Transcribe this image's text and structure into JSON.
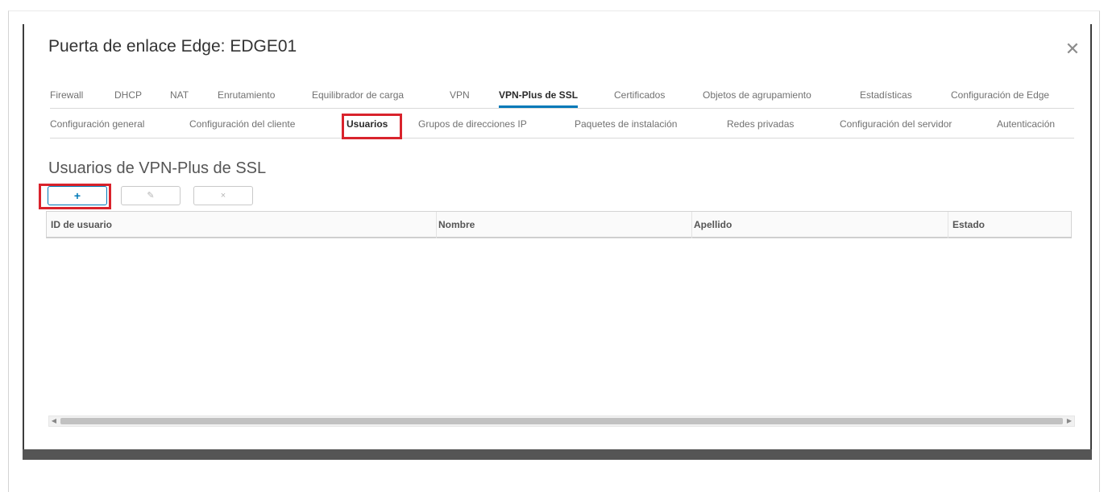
{
  "dialog": {
    "title": "Puerta de enlace Edge: EDGE01",
    "close_icon": "close-icon",
    "tabs": [
      {
        "label": "Firewall",
        "active": false
      },
      {
        "label": "DHCP",
        "active": false
      },
      {
        "label": "NAT",
        "active": false
      },
      {
        "label": "Enrutamiento",
        "active": false
      },
      {
        "label": "Equilibrador de carga",
        "active": false
      },
      {
        "label": "VPN",
        "active": false
      },
      {
        "label": "VPN-Plus de SSL",
        "active": true
      },
      {
        "label": "Certificados",
        "active": false
      },
      {
        "label": "Objetos de agrupamiento",
        "active": false
      },
      {
        "label": "Estadísticas",
        "active": false
      },
      {
        "label": "Configuración de Edge",
        "active": false
      }
    ],
    "subtabs": [
      {
        "label": "Configuración general",
        "active": false
      },
      {
        "label": "Configuración del cliente",
        "active": false
      },
      {
        "label": "Usuarios",
        "active": true
      },
      {
        "label": "Grupos de direcciones IP",
        "active": false
      },
      {
        "label": "Paquetes de instalación",
        "active": false
      },
      {
        "label": "Redes privadas",
        "active": false
      },
      {
        "label": "Configuración del servidor",
        "active": false
      },
      {
        "label": "Autenticación",
        "active": false
      }
    ],
    "section_title": "Usuarios de VPN-Plus de SSL",
    "toolbar": {
      "add_label": "+",
      "edit_icon": "edit-icon",
      "delete_label": "×"
    },
    "grid": {
      "columns": [
        "ID de usuario",
        "Nombre",
        "Apellido",
        "Estado"
      ]
    },
    "scrollbar": {
      "left_arrow": "◀",
      "right_arrow": "▶"
    }
  },
  "colors": {
    "accent": "#0079b8",
    "highlight": "#d9232c"
  }
}
